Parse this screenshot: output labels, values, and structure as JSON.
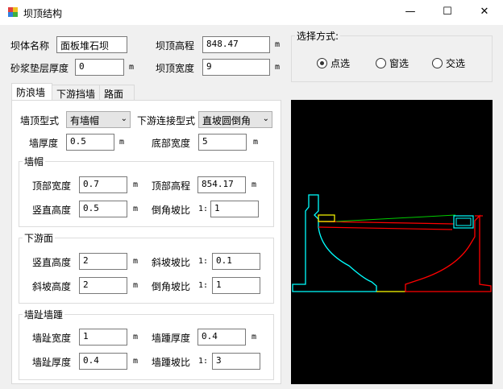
{
  "window": {
    "title": "坝顶结构",
    "minimize": "—",
    "maximize": "☐",
    "close": "✕"
  },
  "top": {
    "dam_name_label": "坝体名称",
    "dam_name_value": "面板堆石坝",
    "crest_elev_label": "坝顶高程",
    "crest_elev_value": "848.47",
    "crest_elev_unit": "m",
    "mortar_label": "砂浆垫层厚度",
    "mortar_value": "0",
    "mortar_unit": "m",
    "crest_width_label": "坝顶宽度",
    "crest_width_value": "9",
    "crest_width_unit": "m"
  },
  "select_mode": {
    "title": "选择方式:",
    "options": [
      {
        "label": "点选",
        "checked": true
      },
      {
        "label": "窗选",
        "checked": false
      },
      {
        "label": "交选",
        "checked": false
      }
    ]
  },
  "tabs": [
    {
      "label": "防浪墙",
      "active": true
    },
    {
      "label": "下游挡墙",
      "active": false
    },
    {
      "label": "路面",
      "active": false
    }
  ],
  "wall": {
    "type_label": "墙顶型式",
    "type_value": "有墙帽",
    "connect_label": "下游连接型式",
    "connect_value": "直坡圆倒角",
    "thickness_label": "墙厚度",
    "thickness_value": "0.5",
    "thickness_unit": "m",
    "base_width_label": "底部宽度",
    "base_width_value": "5",
    "base_width_unit": "m"
  },
  "cap": {
    "title": "墙帽",
    "top_width_label": "顶部宽度",
    "top_width_value": "0.7",
    "top_width_unit": "m",
    "top_elev_label": "顶部高程",
    "top_elev_value": "854.17",
    "top_elev_unit": "m",
    "vert_height_label": "竖直高度",
    "vert_height_value": "0.5",
    "vert_height_unit": "m",
    "chamfer_label": "倒角坡比",
    "chamfer_prefix": "1:",
    "chamfer_value": "1"
  },
  "downstream": {
    "title": "下游面",
    "vert_height_label": "竖直高度",
    "vert_height_value": "2",
    "vert_height_unit": "m",
    "slope_ratio_label": "斜坡坡比",
    "slope_ratio_prefix": "1:",
    "slope_ratio_value": "0.1",
    "slope_height_label": "斜坡高度",
    "slope_height_value": "2",
    "slope_height_unit": "m",
    "chamfer_label": "倒角坡比",
    "chamfer_prefix": "1:",
    "chamfer_value": "1"
  },
  "toe": {
    "title": "墙趾墙踵",
    "toe_width_label": "墙趾宽度",
    "toe_width_value": "1",
    "toe_width_unit": "m",
    "heel_thick_label": "墙踵厚度",
    "heel_thick_value": "0.4",
    "heel_thick_unit": "m",
    "toe_thick_label": "墙趾厚度",
    "toe_thick_value": "0.4",
    "toe_thick_unit": "m",
    "heel_slope_label": "墙踵坡比",
    "heel_slope_prefix": "1:",
    "heel_slope_value": "3"
  },
  "colors": {
    "cyan": "#00ffff",
    "red": "#ff0000",
    "yellow": "#ffff00",
    "green": "#00cc00",
    "canvas_bg": "#000000"
  }
}
